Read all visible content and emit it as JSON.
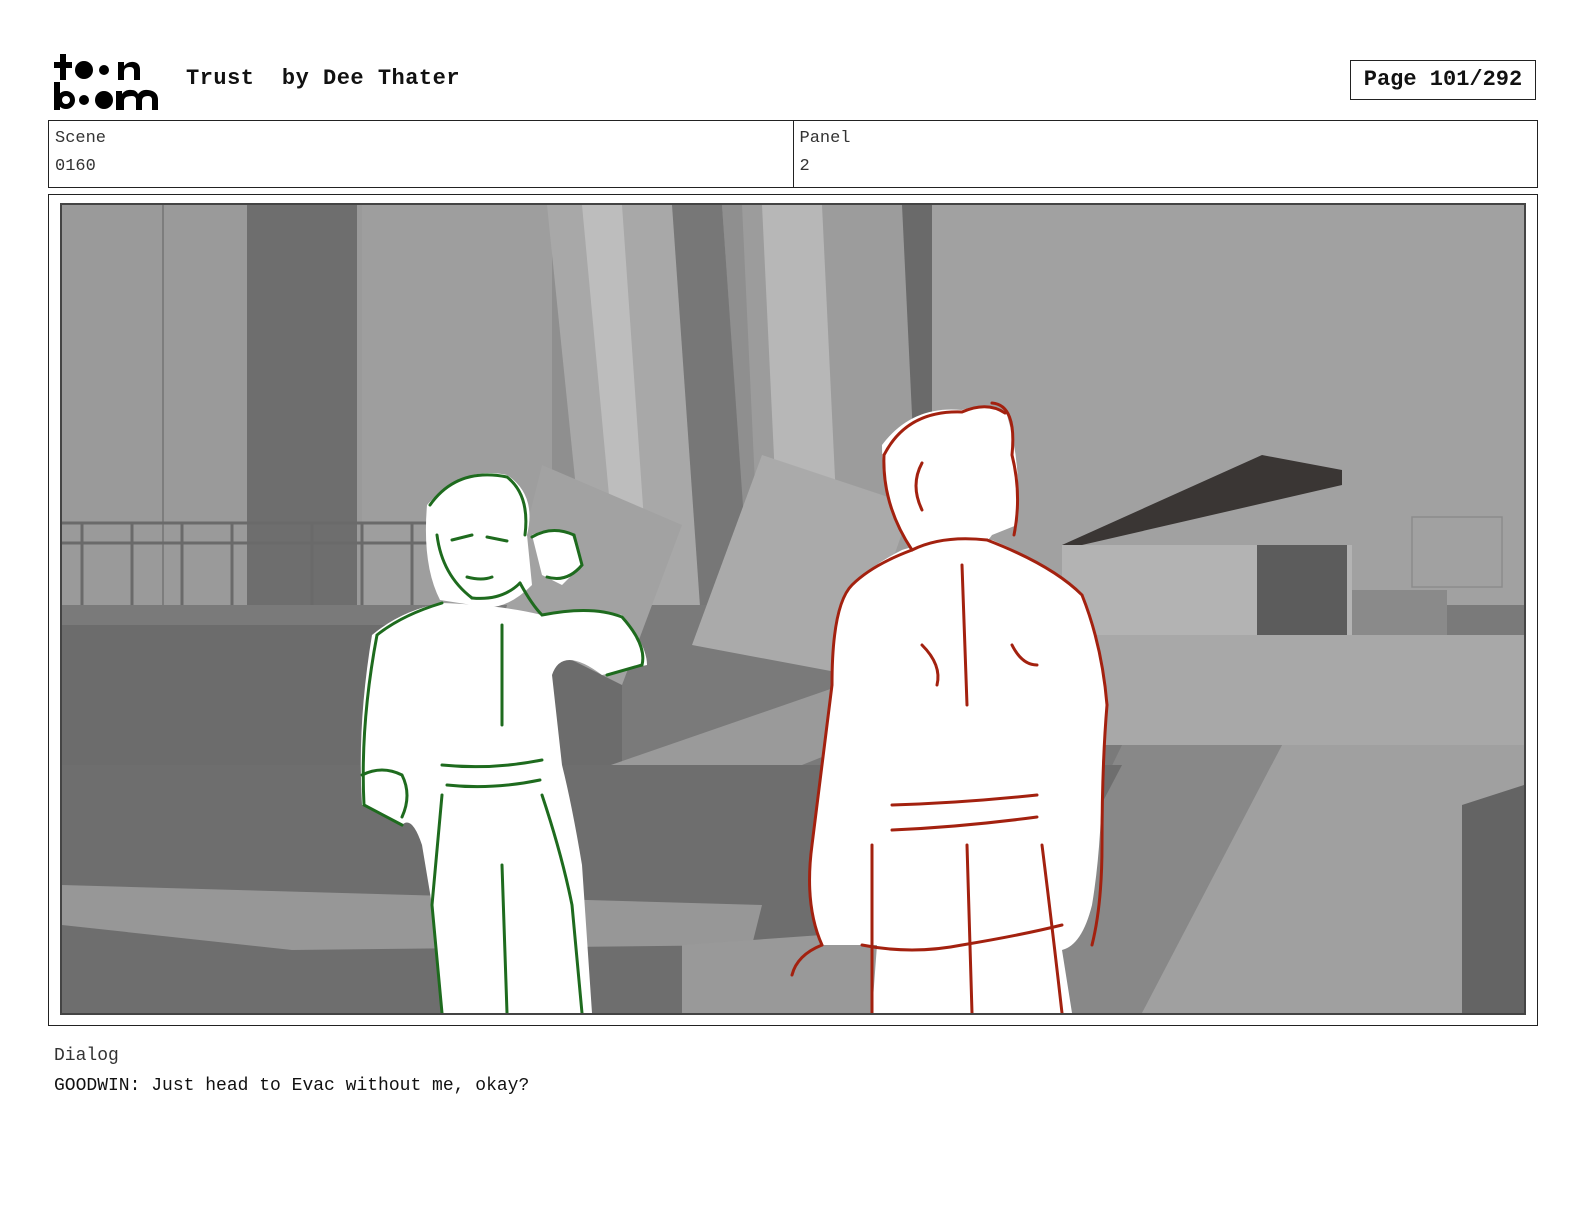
{
  "header": {
    "logo_text": "toon boom",
    "title": "Trust  by Dee Thater",
    "page": "Page 101/292"
  },
  "info": {
    "scene_label": "Scene",
    "scene_value": "0160",
    "panel_label": "Panel",
    "panel_value": "2"
  },
  "dialog": {
    "label": "Dialog",
    "text": "GOODWIN: Just head to Evac without me, okay?"
  },
  "colors": {
    "left_character_stroke": "#1e6b1e",
    "right_character_stroke": "#a3210f"
  }
}
